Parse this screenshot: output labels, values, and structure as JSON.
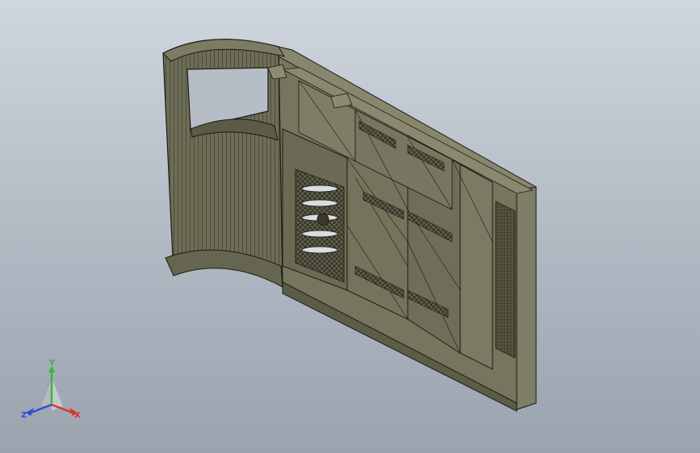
{
  "triad": {
    "x_label": "X",
    "y_label": "Y",
    "z_label": "Z",
    "x_color": "#e0302a",
    "y_color": "#36b83a",
    "z_color": "#2a4fd6"
  },
  "model": {
    "fill_color": "#6f6e58",
    "edge_color": "#1b1b14",
    "viewport_background_top": "#cfd6de",
    "viewport_background_bottom": "#9aa3ae"
  }
}
